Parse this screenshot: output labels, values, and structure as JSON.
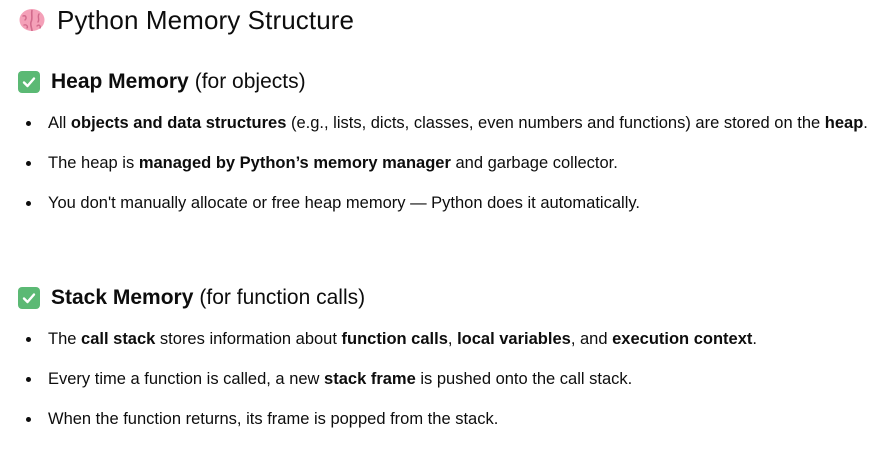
{
  "title": "Python Memory Structure",
  "title_icon": "brain-icon",
  "sections": [
    {
      "icon": "check-mark-button-icon",
      "heading_bold": "Heap Memory",
      "heading_rest": "(for objects)",
      "items": [
        [
          {
            "t": "All "
          },
          {
            "t": "objects and data structures",
            "b": true
          },
          {
            "t": " (e.g., lists, dicts, classes, even numbers and functions) are stored on the "
          },
          {
            "t": "heap",
            "b": true
          },
          {
            "t": "."
          }
        ],
        [
          {
            "t": "The heap is "
          },
          {
            "t": "managed by Python’s memory manager",
            "b": true
          },
          {
            "t": " and garbage collector."
          }
        ],
        [
          {
            "t": "You don't manually allocate or free heap memory — Python does it automatically."
          }
        ]
      ]
    },
    {
      "icon": "check-mark-button-icon",
      "heading_bold": "Stack Memory",
      "heading_rest": "(for function calls)",
      "items": [
        [
          {
            "t": "The "
          },
          {
            "t": "call stack",
            "b": true
          },
          {
            "t": " stores information about "
          },
          {
            "t": "function calls",
            "b": true
          },
          {
            "t": ", "
          },
          {
            "t": "local variables",
            "b": true
          },
          {
            "t": ", and "
          },
          {
            "t": "execution context",
            "b": true
          },
          {
            "t": "."
          }
        ],
        [
          {
            "t": "Every time a function is called, a new "
          },
          {
            "t": "stack frame",
            "b": true
          },
          {
            "t": " is pushed onto the call stack."
          }
        ],
        [
          {
            "t": "When the function returns, its frame is popped from the stack."
          }
        ]
      ]
    }
  ],
  "colors": {
    "check_bg": "#5bb974",
    "text": "#0d0d0d",
    "brain": "#f4a0b8"
  }
}
